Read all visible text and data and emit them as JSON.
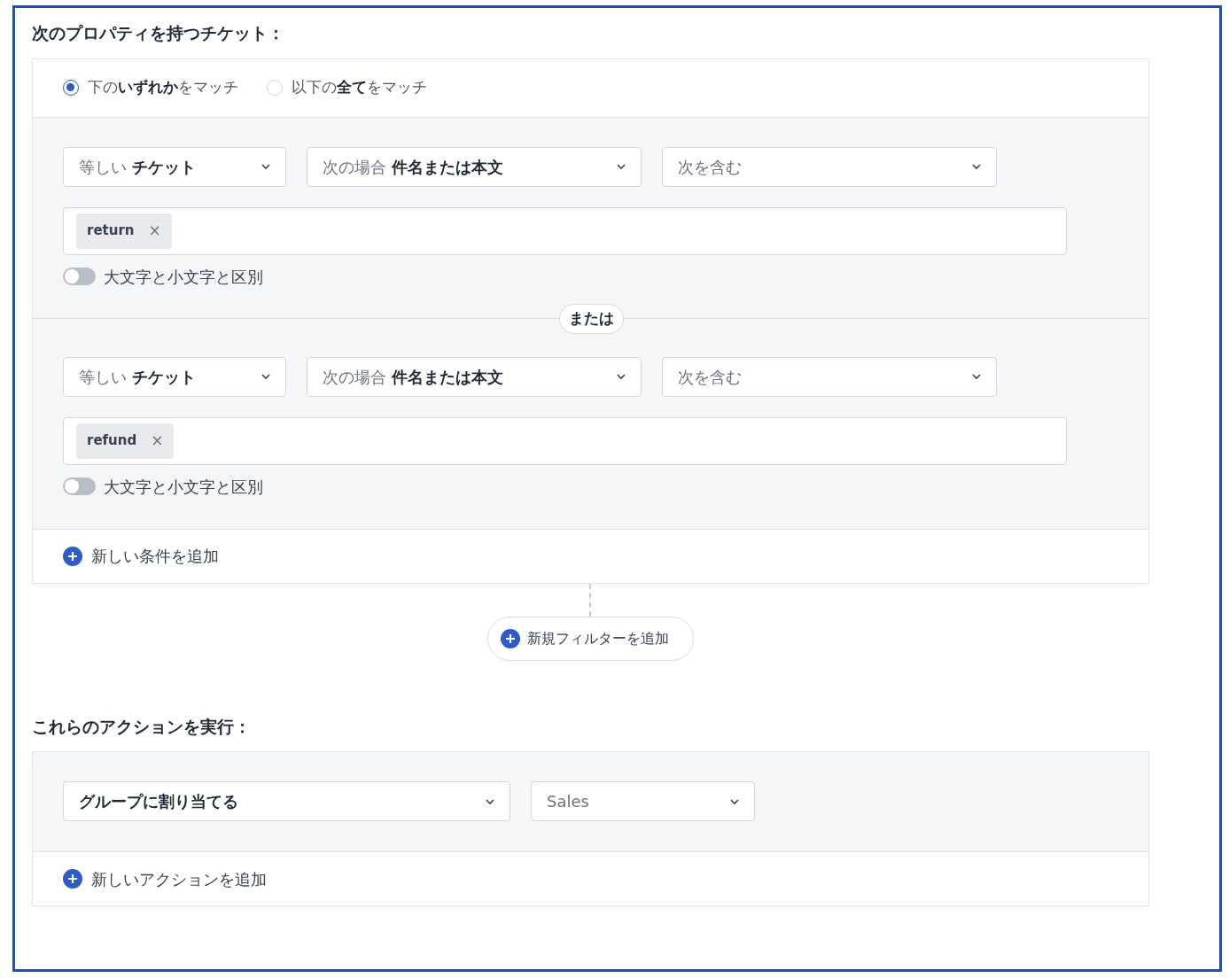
{
  "conditions_heading": "次のプロパティを持つチケット：",
  "match_options": [
    {
      "label": "下の**いずれか**をマッチ",
      "selected": true
    },
    {
      "label": "以下の**全て**をマッチ",
      "selected": false
    }
  ],
  "conditions": [
    {
      "dropdowns": [
        "等しい **チケット**",
        "次の場合 **件名または本文**",
        "次を含む"
      ],
      "tags": [
        {
          "label": "return",
          "remove": "×"
        }
      ],
      "case_toggle": {
        "label": "大文字と小文字と区別",
        "on": false
      }
    },
    {
      "dropdowns": [
        "等しい **チケット**",
        "次の場合 **件名または本文**",
        "次を含む"
      ],
      "tags": [
        {
          "label": "refund",
          "remove": "×"
        }
      ],
      "case_toggle": {
        "label": "大文字と小文字と区別",
        "on": false
      }
    }
  ],
  "separator": "または",
  "add_condition": "新しい条件を追加",
  "add_filter": "新規フィルターを追加",
  "actions_heading": "これらのアクションを実行：",
  "actions": [
    {
      "dropdowns": [
        "**グループに割り当てる**",
        "Sales"
      ]
    }
  ],
  "add_action": "新しいアクションを追加"
}
